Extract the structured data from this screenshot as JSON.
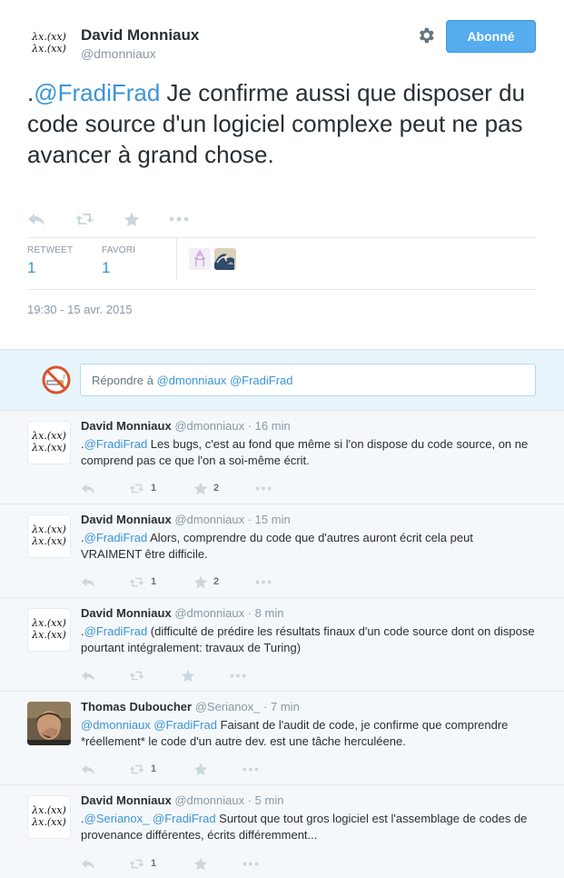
{
  "tweet": {
    "author_name": "David Monniaux",
    "author_handle": "@dmonniaux",
    "avatar_text": [
      "λx.(xx)",
      "λx.(xx)"
    ],
    "follow_label": "Abonné",
    "text_prefix": ".",
    "mention": "@FradiFrad",
    "text_body": " Je confirme aussi que disposer du code source d'un logiciel complexe peut ne pas avancer à grand chose.",
    "retweet_label": "RETWEET",
    "retweet_count": "1",
    "favorite_label": "FAVORI",
    "favorite_count": "1",
    "timestamp": "19:30 - 15 avr. 2015"
  },
  "reply_box": {
    "placeholder_prefix": "Répondre à ",
    "placeholder_mentions": "@dmonniaux @FradiFrad"
  },
  "replies": [
    {
      "name": "David Monniaux",
      "handle": "@dmonniaux",
      "time": "16 min",
      "avatar": "lambda",
      "prefix": ".",
      "mentions": [
        "@FradiFrad"
      ],
      "text": " Les bugs, c'est au fond que même si l'on dispose du code source, on ne comprend pas ce que l'on a soi-même écrit.",
      "retweets": "1",
      "favorites": "2"
    },
    {
      "name": "David Monniaux",
      "handle": "@dmonniaux",
      "time": "15 min",
      "avatar": "lambda",
      "prefix": ".",
      "mentions": [
        "@FradiFrad"
      ],
      "text": " Alors, comprendre du code que d'autres auront écrit cela peut VRAIMENT être difficile.",
      "retweets": "1",
      "favorites": "2"
    },
    {
      "name": "David Monniaux",
      "handle": "@dmonniaux",
      "time": "8 min",
      "avatar": "lambda",
      "prefix": ".",
      "mentions": [
        "@FradiFrad"
      ],
      "text": " (difficulté de prédire les résultats finaux d'un code source dont on dispose pourtant intégralement: travaux de Turing)",
      "retweets": "",
      "favorites": ""
    },
    {
      "name": "Thomas Duboucher",
      "handle": "@Serianox_",
      "time": "7 min",
      "avatar": "photo",
      "prefix": "",
      "mentions": [
        "@dmonniaux",
        "@FradiFrad"
      ],
      "text": " Faisant de l'audit de code, je confirme que comprendre *réellement* le code d'un autre dev. est une tâche herculéene.",
      "retweets": "1",
      "favorites": ""
    },
    {
      "name": "David Monniaux",
      "handle": "@dmonniaux",
      "time": "5 min",
      "avatar": "lambda",
      "prefix": ".",
      "mentions": [
        "@Serianox_",
        "@FradiFrad"
      ],
      "text": " Surtout que tout gros logiciel est l'assemblage de codes de provenance différentes, écrits différemment...",
      "retweets": "1",
      "favorites": ""
    }
  ],
  "colors": {
    "accent": "#55acee",
    "link": "#3b94d9",
    "muted": "#8899a6",
    "icon": "#ccd6dd",
    "reply_bg": "#f5f8fa"
  },
  "icons": [
    "gear-icon",
    "reply-icon",
    "retweet-icon",
    "star-icon",
    "more-icon",
    "no-smoking-icon"
  ]
}
